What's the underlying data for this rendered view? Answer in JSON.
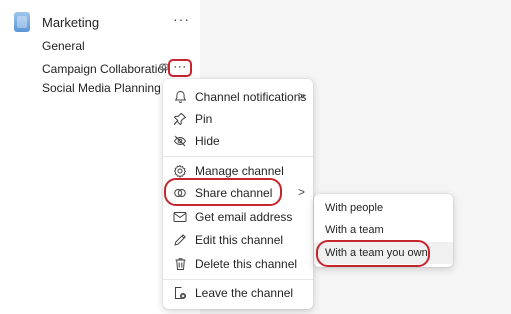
{
  "sidebar": {
    "team": {
      "name": "Marketing",
      "more": "···"
    },
    "channels": [
      {
        "label": "General"
      },
      {
        "label": "Campaign Collaboration"
      },
      {
        "label": "Social Media Planning"
      }
    ],
    "more_button": "···"
  },
  "context_menu": {
    "items": [
      {
        "label": "Channel notifications",
        "icon": "bell-icon",
        "has_submenu": true
      },
      {
        "label": "Pin",
        "icon": "pin-icon"
      },
      {
        "label": "Hide",
        "icon": "eye-off-icon"
      },
      {
        "label": "Manage channel",
        "icon": "gear-icon"
      },
      {
        "label": "Share channel",
        "icon": "share-channel-icon",
        "has_submenu": true,
        "highlighted": true
      },
      {
        "label": "Get email address",
        "icon": "mail-icon"
      },
      {
        "label": "Edit this channel",
        "icon": "pencil-icon"
      },
      {
        "label": "Delete this channel",
        "icon": "trash-icon"
      },
      {
        "label": "Leave the channel",
        "icon": "leave-icon"
      }
    ],
    "arrow": ">"
  },
  "share_submenu": {
    "items": [
      {
        "label": "With people"
      },
      {
        "label": "With a team"
      },
      {
        "label": "With a team you own",
        "highlighted": true
      }
    ]
  },
  "colors": {
    "highlight_ring": "#c4262e",
    "sidebar_bg": "#ffffff",
    "canvas_bg": "#f5f5f5"
  }
}
